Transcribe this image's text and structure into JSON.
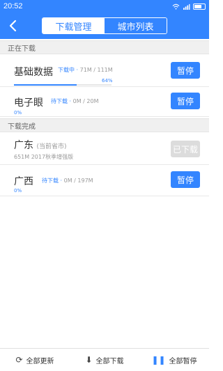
{
  "status_bar": {
    "time": "20:52"
  },
  "nav": {
    "back_icon": "back-arrow-icon",
    "tabs": [
      {
        "label": "下载管理",
        "active": true
      },
      {
        "label": "城市列表",
        "active": false
      }
    ]
  },
  "sections": {
    "downloading": "正在下载",
    "completed": "下载完成"
  },
  "items": [
    {
      "name": "基础数据",
      "status": "下载中",
      "size": "71M / 111M",
      "progress_percent": 64,
      "progress_label": "64%",
      "button": "暂停"
    },
    {
      "name": "电子眼",
      "status": "待下载",
      "size": "0M / 20M",
      "progress_percent": 0,
      "progress_label": "0%",
      "button": "暂停"
    },
    {
      "name": "广东",
      "tag": "(当前省市)",
      "sub": "651M  2017秋季增强版",
      "button": "已下载"
    },
    {
      "name": "广西",
      "status": "待下载",
      "size": "0M / 197M",
      "progress_percent": 0,
      "progress_label": "0%",
      "button": "暂停"
    }
  ],
  "bottom_bar": {
    "update_all": "全部更新",
    "download_all": "全部下载",
    "pause_all": "全部暂停"
  }
}
